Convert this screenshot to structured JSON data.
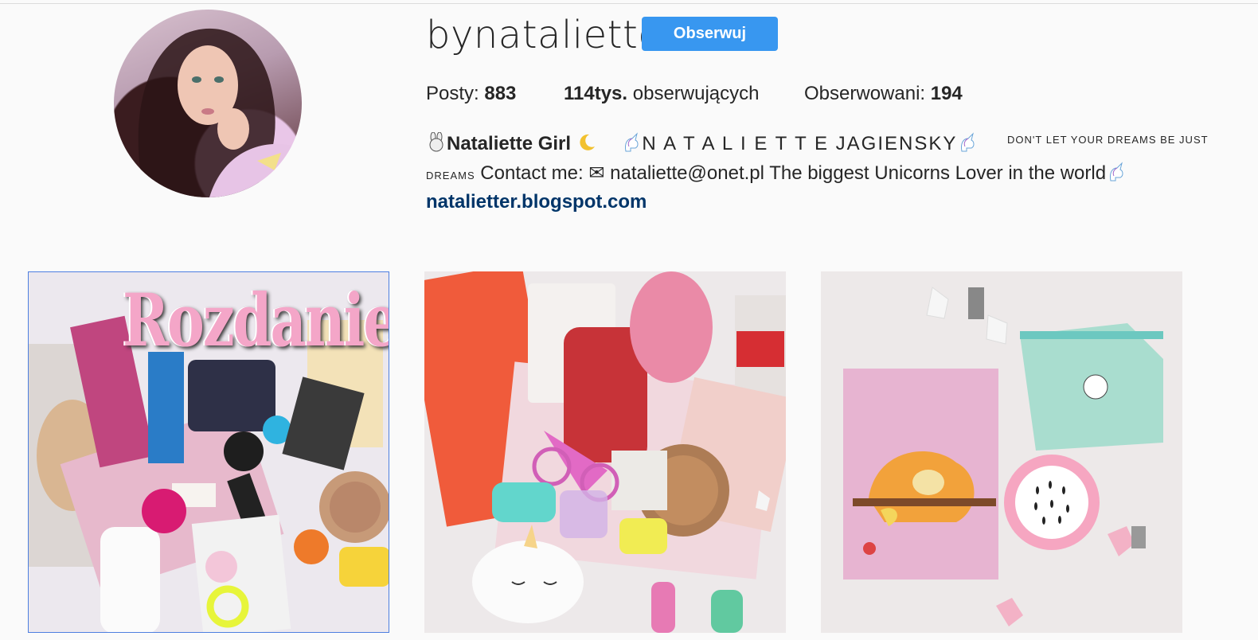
{
  "profile": {
    "username": "bynataliette",
    "follow_label": "Obserwuj",
    "avatar_icon": "profile-photo"
  },
  "stats": {
    "posts_label": "Posty: ",
    "posts_value": "883",
    "followers_value": "114tys.",
    "followers_label": " obserwujących",
    "following_label": "Obserwowani: ",
    "following_value": "194"
  },
  "bio": {
    "name": "Nataliette Girl",
    "spaced_name": "N A T A L I E T T E JAGIENSKY",
    "dreams_line": "DON'T LET YOUR DREAMS BE JUST",
    "dreams_end": "DREAMS",
    "contact": " Contact me: ✉ nataliette@onet.pl The biggest Unicorns Lover in the world",
    "link": "natalietter.blogspot.com"
  },
  "posts": [
    {
      "title": "Rozdanie!",
      "icon": "giveaway-photo"
    },
    {
      "icon": "beauty-box-photo"
    },
    {
      "icon": "sloth-mask-photo"
    }
  ],
  "colors": {
    "follow_button": "#3897f0",
    "link": "#003569",
    "background": "#fafafa"
  }
}
